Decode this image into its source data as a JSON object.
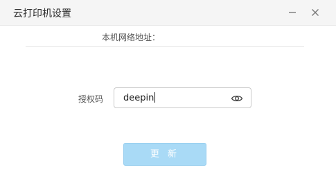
{
  "window": {
    "title": "云打印机设置",
    "minimize_icon": "minimize-icon",
    "close_icon": "close-icon"
  },
  "network": {
    "label": "本机网络地址：",
    "value": ""
  },
  "auth": {
    "label": "授权码",
    "value": "deepin",
    "toggle_icon": "eye-icon"
  },
  "actions": {
    "update_label": "更 新",
    "update_disabled": true
  },
  "colors": {
    "titlebar_bg": "#f5f5f5",
    "button_bg": "#a9daf6",
    "button_text": "#ffffff",
    "input_border": "#c9c9c9"
  }
}
